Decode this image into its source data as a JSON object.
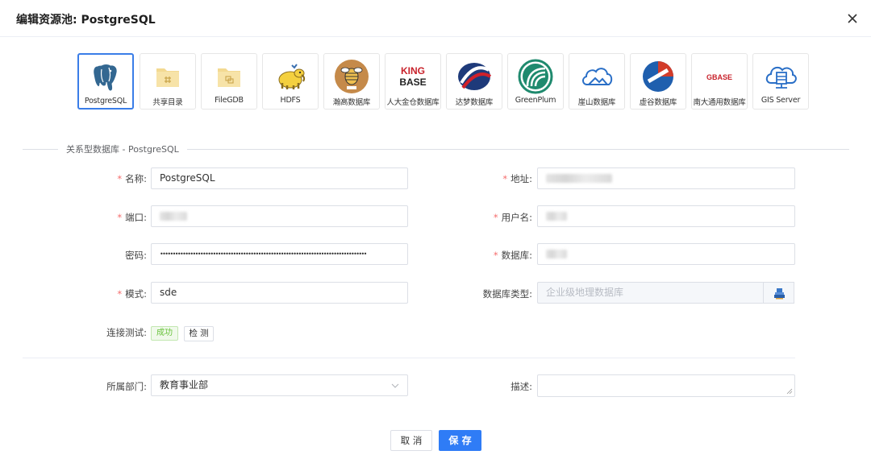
{
  "dialog": {
    "title": "编辑资源池: PostgreSQL"
  },
  "types": [
    {
      "label": "PostgreSQL",
      "icon": "postgresql-elephant-icon",
      "active": true
    },
    {
      "label": "共享目录",
      "icon": "shared-folder-icon",
      "active": false
    },
    {
      "label": "FileGDB",
      "icon": "filegdb-folder-icon",
      "active": false
    },
    {
      "label": "HDFS",
      "icon": "hdfs-hadoop-icon",
      "active": false
    },
    {
      "label": "瀚高数据库",
      "icon": "highgo-db-icon",
      "active": false
    },
    {
      "label": "人大金仓数据库",
      "icon": "kingbase-logo",
      "active": false
    },
    {
      "label": "达梦数据库",
      "icon": "dameng-db-icon",
      "active": false
    },
    {
      "label": "GreenPlum",
      "icon": "greenplum-icon",
      "active": false
    },
    {
      "label": "崖山数据库",
      "icon": "yashan-cloud-icon",
      "active": false
    },
    {
      "label": "虚谷数据库",
      "icon": "xugu-db-icon",
      "active": false
    },
    {
      "label": "南大通用数据库",
      "icon": "gbase-logo",
      "active": false
    },
    {
      "label": "GIS Server",
      "icon": "gis-server-cloud-icon",
      "active": false
    }
  ],
  "kingbase_logo": {
    "line1": "KING",
    "line2": "BASE"
  },
  "gbase_logo": "GBASE",
  "section_title": "关系型数据库 - PostgreSQL",
  "form": {
    "name_label": "名称:",
    "name_value": "PostgreSQL",
    "address_label": "地址:",
    "port_label": "端口:",
    "username_label": "用户名:",
    "password_label": "密码:",
    "password_value": "••••••••••••••••••••••••••••••••••••••••••••••••••••••••••••••••••••••••••••••••••",
    "database_label": "数据库:",
    "schema_label": "模式:",
    "schema_value": "sde",
    "dbtype_label": "数据库类型:",
    "dbtype_placeholder": "企业级地理数据库",
    "conn_test_label": "连接测试:",
    "conn_status": "成功",
    "test_button": "检 测",
    "department_label": "所属部门:",
    "department_value": "教育事业部",
    "description_label": "描述:"
  },
  "footer": {
    "cancel": "取 消",
    "save": "保 存"
  },
  "colors": {
    "primary": "#2f7cf6",
    "required": "#f56c6c",
    "success": "#67c23a",
    "active_border": "#3a7de8"
  }
}
